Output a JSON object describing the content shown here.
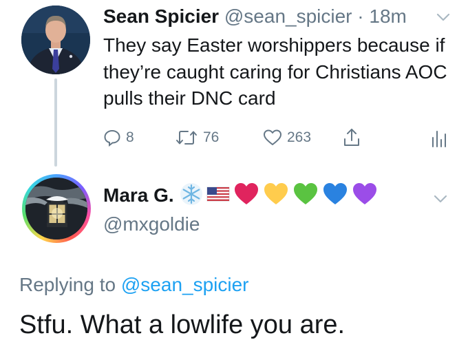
{
  "tweet": {
    "author_name": "Sean Spicier",
    "author_handle": "@sean_spicier",
    "separator": "·",
    "time": "18m",
    "text": "They say Easter worshippers because if they’re caught caring for Christians AOC pulls their DNC card",
    "actions": {
      "reply_count": "8",
      "retweet_count": "76",
      "like_count": "263"
    }
  },
  "reply": {
    "author_name": "Mara G.",
    "author_handle": "@mxgoldie",
    "name_emojis": [
      "snowflake-icon",
      "us-flag-icon",
      "red-heart-icon",
      "yellow-heart-icon",
      "green-heart-icon",
      "blue-heart-icon",
      "purple-heart-icon"
    ],
    "replying_prefix": "Replying to",
    "replying_to": "@sean_spicier",
    "text": "Stfu. What a lowlife you are."
  },
  "colors": {
    "text_primary": "#14171a",
    "text_secondary": "#657786",
    "link": "#1da1f2",
    "thread_line": "#ccd6dd",
    "heart_red": "#e0245e",
    "heart_yellow": "#ffcc4d",
    "heart_green": "#5ac341",
    "heart_blue": "#2a82e0",
    "heart_purple": "#9b4de8"
  }
}
